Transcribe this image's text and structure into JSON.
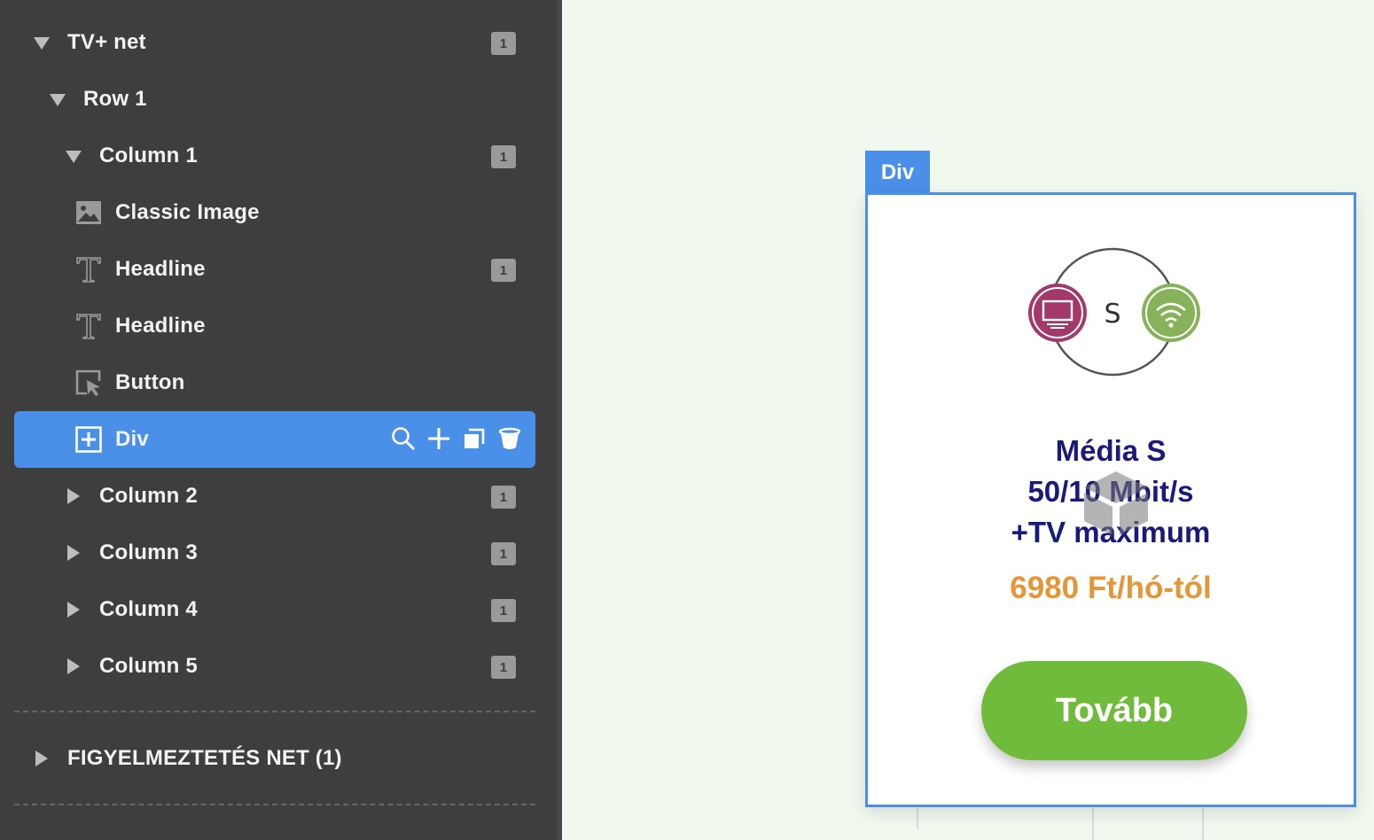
{
  "sidebar": {
    "items": [
      {
        "label": "TV+ net",
        "badge": "1"
      },
      {
        "label": "Row 1"
      },
      {
        "label": "Column 1",
        "badge": "1"
      },
      {
        "label": "Classic Image"
      },
      {
        "label": "Headline",
        "badge": "1"
      },
      {
        "label": "Headline"
      },
      {
        "label": "Button"
      },
      {
        "label": "Div"
      },
      {
        "label": "Column 2",
        "badge": "1"
      },
      {
        "label": "Column 3",
        "badge": "1"
      },
      {
        "label": "Column 4",
        "badge": "1"
      },
      {
        "label": "Column 5",
        "badge": "1"
      }
    ],
    "section2": {
      "label": "FIGYELMEZTETÉS NET (1)"
    }
  },
  "canvas": {
    "selection_tag": "Div",
    "card": {
      "logo_letter": "S",
      "title_lines": [
        "Média S",
        "50/10 Mbit/s",
        "+TV maximum"
      ],
      "price": "6980 Ft/hó-tól",
      "button_label": "Tovább"
    }
  },
  "colors": {
    "selected": "#4a8fe8",
    "title": "#1a1a7a",
    "price": "#e59636",
    "button": "#70bb3c",
    "tv_circle": "#a3386a",
    "wifi_circle": "#86b25a"
  },
  "icons": {
    "expanded": "triangle-down-icon",
    "collapsed": "triangle-right-icon",
    "image": "image-icon",
    "text": "text-icon",
    "button": "cursor-icon",
    "div": "plus-square-icon",
    "actions": [
      "search-icon",
      "plus-icon",
      "copy-icon",
      "trash-icon"
    ]
  }
}
